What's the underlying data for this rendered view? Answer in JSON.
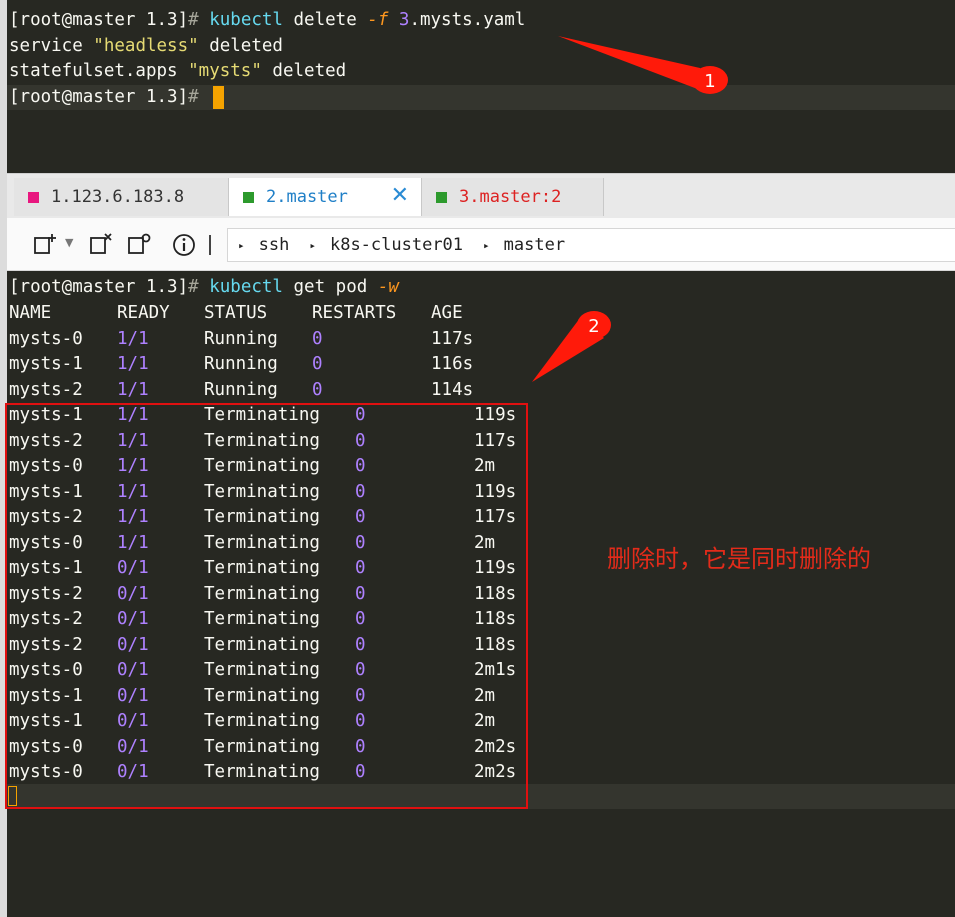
{
  "terminal_top": {
    "lines": [
      {
        "prompt": "[root@master 1.3]",
        "hash": "#",
        "cmd": "kubectl",
        "args": [
          " delete ",
          "-f",
          " ",
          "3",
          ".mysts.yaml"
        ]
      },
      {
        "text": [
          "service ",
          "\"headless\"",
          " deleted"
        ]
      },
      {
        "text": [
          "statefulset.apps ",
          "\"mysts\"",
          " deleted"
        ]
      },
      {
        "prompt": "[root@master 1.3]",
        "hash": "#"
      }
    ]
  },
  "tabs": [
    {
      "label": "1.123.6.183.8",
      "color": "#e8177f"
    },
    {
      "label": "2.master",
      "color": "#2d9a2d",
      "close": "✕"
    },
    {
      "label": "3.master:2",
      "color": "#2d9a2d"
    }
  ],
  "toolbar": {
    "breadcrumb": [
      "ssh",
      "k8s-cluster01",
      "master"
    ],
    "sep": "▸"
  },
  "terminal_bottom": {
    "prompt": "[root@master 1.3]",
    "hash": "#",
    "cmd": "kubectl",
    "args": " get pod ",
    "flag": "-w",
    "header": [
      "NAME",
      "READY",
      "STATUS",
      "RESTARTS",
      "AGE"
    ],
    "running_rows": [
      [
        "mysts-0",
        "1/1",
        "Running",
        "0",
        "117s"
      ],
      [
        "mysts-1",
        "1/1",
        "Running",
        "0",
        "116s"
      ],
      [
        "mysts-2",
        "1/1",
        "Running",
        "0",
        "114s"
      ]
    ],
    "terminating_rows": [
      [
        "mysts-1",
        "1/1",
        "Terminating",
        "0",
        "119s"
      ],
      [
        "mysts-2",
        "1/1",
        "Terminating",
        "0",
        "117s"
      ],
      [
        "mysts-0",
        "1/1",
        "Terminating",
        "0",
        "2m"
      ],
      [
        "mysts-1",
        "1/1",
        "Terminating",
        "0",
        "119s"
      ],
      [
        "mysts-2",
        "1/1",
        "Terminating",
        "0",
        "117s"
      ],
      [
        "mysts-0",
        "1/1",
        "Terminating",
        "0",
        "2m"
      ],
      [
        "mysts-1",
        "0/1",
        "Terminating",
        "0",
        "119s"
      ],
      [
        "mysts-2",
        "0/1",
        "Terminating",
        "0",
        "118s"
      ],
      [
        "mysts-2",
        "0/1",
        "Terminating",
        "0",
        "118s"
      ],
      [
        "mysts-2",
        "0/1",
        "Terminating",
        "0",
        "118s"
      ],
      [
        "mysts-0",
        "0/1",
        "Terminating",
        "0",
        "2m1s"
      ],
      [
        "mysts-1",
        "0/1",
        "Terminating",
        "0",
        "2m"
      ],
      [
        "mysts-1",
        "0/1",
        "Terminating",
        "0",
        "2m"
      ],
      [
        "mysts-0",
        "0/1",
        "Terminating",
        "0",
        "2m2s"
      ],
      [
        "mysts-0",
        "0/1",
        "Terminating",
        "0",
        "2m2s"
      ]
    ]
  },
  "annotations": {
    "badge1": "1",
    "badge2": "2",
    "note": "删除时，它是同时删除的",
    "color": "#e32b1a"
  }
}
